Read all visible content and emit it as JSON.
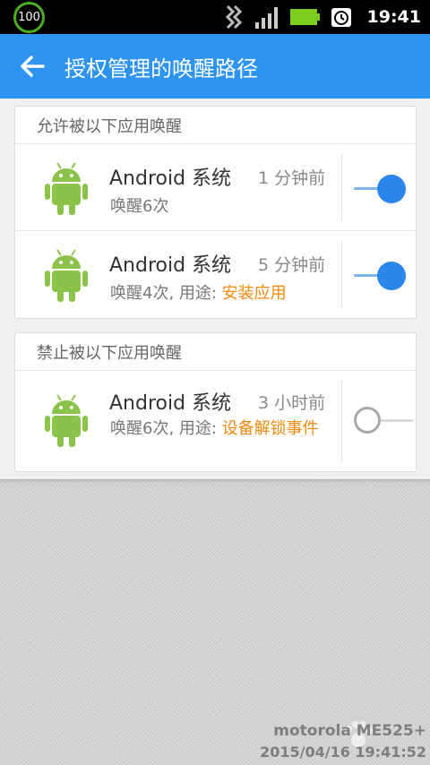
{
  "status_bar": {
    "battery_percent": "100",
    "time": "19:41",
    "icons": [
      "battery-ring-icon",
      "data-activity-icon",
      "signal-icon",
      "battery-icon",
      "alarm-icon"
    ]
  },
  "app_bar": {
    "back_icon": "arrow-left-icon",
    "title": "授权管理的唤醒路径"
  },
  "allowed": {
    "header": "允许被以下应用唤醒",
    "items": [
      {
        "name": "Android 系统",
        "time": "1 分钟前",
        "detail": "唤醒6次",
        "purpose_label": "",
        "purpose": "",
        "enabled": true
      },
      {
        "name": "Android 系统",
        "time": "5 分钟前",
        "detail": "唤醒4次, 用途: ",
        "purpose_label": "",
        "purpose": "安装应用",
        "enabled": true
      }
    ]
  },
  "blocked": {
    "header": "禁止被以下应用唤醒",
    "items": [
      {
        "name": "Android 系统",
        "time": "3 小时前",
        "detail": "唤醒6次, 用途: ",
        "purpose": "设备解锁事件",
        "enabled": false
      }
    ]
  },
  "watermark": {
    "device": "motorola ME525+",
    "datetime": "2015/04/16 19:41:52"
  },
  "colors": {
    "app_bar": "#2d94f2",
    "toggle_on": "#2a86ea",
    "highlight": "#f08a0c",
    "android_green": "#8bc34a"
  }
}
